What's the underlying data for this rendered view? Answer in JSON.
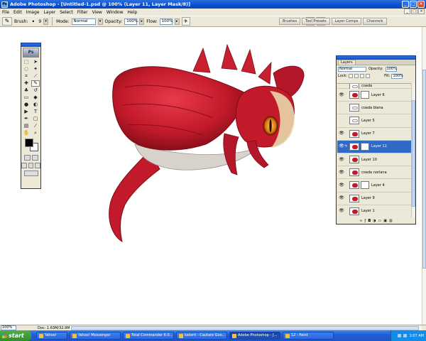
{
  "window": {
    "title": "Adobe Photoshop - [Untitled-1.psd @ 100% (Layer 11, Layer Mask/8)]",
    "app_icon": "Ps",
    "minimize": "_",
    "maximize": "□",
    "close": "×"
  },
  "menu": {
    "items": [
      "File",
      "Edit",
      "Image",
      "Layer",
      "Select",
      "Filter",
      "View",
      "Window",
      "Help"
    ],
    "doc_controls": [
      "_",
      "□",
      "×"
    ]
  },
  "options_bar": {
    "brush_label": "Brush:",
    "brush_size": "9",
    "mode_label": "Mode:",
    "mode_value": "Normal",
    "opacity_label": "Opacity:",
    "opacity_value": "100%",
    "flow_label": "Flow:",
    "flow_value": "100%",
    "palette_well": [
      "Brushes",
      "Tool Presets",
      "Layer Comps",
      "Channels"
    ]
  },
  "layers_panel": {
    "tab": "Layers",
    "blend_mode": "Normal",
    "opacity_label": "Opacity:",
    "opacity_value": "100%",
    "lock_label": "Lock:",
    "fill_label": "Fill:",
    "fill_value": "100%",
    "layers": [
      {
        "name": "coada",
        "visible": false,
        "thumb": "sketch",
        "mask": false,
        "partial": true
      },
      {
        "name": "Layer 6",
        "visible": true,
        "thumb": "red",
        "mask": true
      },
      {
        "name": "coada blana",
        "visible": false,
        "thumb": "sketch",
        "mask": false
      },
      {
        "name": "Layer 5",
        "visible": false,
        "thumb": "sketch",
        "mask": false
      },
      {
        "name": "Layer 7",
        "visible": true,
        "thumb": "red",
        "mask": false
      },
      {
        "name": "Layer 11",
        "visible": true,
        "thumb": "red",
        "mask": true,
        "selected": true
      },
      {
        "name": "Layer 10",
        "visible": true,
        "thumb": "red",
        "mask": false
      },
      {
        "name": "coada norlana",
        "visible": true,
        "thumb": "red",
        "mask": false
      },
      {
        "name": "Layer 4",
        "visible": true,
        "thumb": "red",
        "mask": true
      },
      {
        "name": "Layer 9",
        "visible": true,
        "thumb": "red",
        "mask": false
      },
      {
        "name": "Layer 1",
        "visible": true,
        "thumb": "red",
        "mask": false
      }
    ]
  },
  "status_bar": {
    "zoom": "100%",
    "doc_info": "Doc: 1.63M/32.9M"
  },
  "taskbar": {
    "start_label": "start",
    "tasks": [
      {
        "label": "Yahoo!",
        "short": true,
        "active": false
      },
      {
        "label": "Yahoo! Messenger",
        "short": false,
        "active": false
      },
      {
        "label": "Total Commander 6.0...",
        "short": false,
        "active": false
      },
      {
        "label": "katerri - Cautare Goo...",
        "short": false,
        "active": false
      },
      {
        "label": "Adobe Photoshop - [...",
        "short": false,
        "active": true
      },
      {
        "label": "12 - Paint",
        "short": false,
        "active": false
      }
    ],
    "clock": "1:07 AM"
  },
  "colors": {
    "titlebar_blue": "#0a4fcf",
    "selected_layer": "#316ac5",
    "dragon_red": "#c21a2a"
  }
}
